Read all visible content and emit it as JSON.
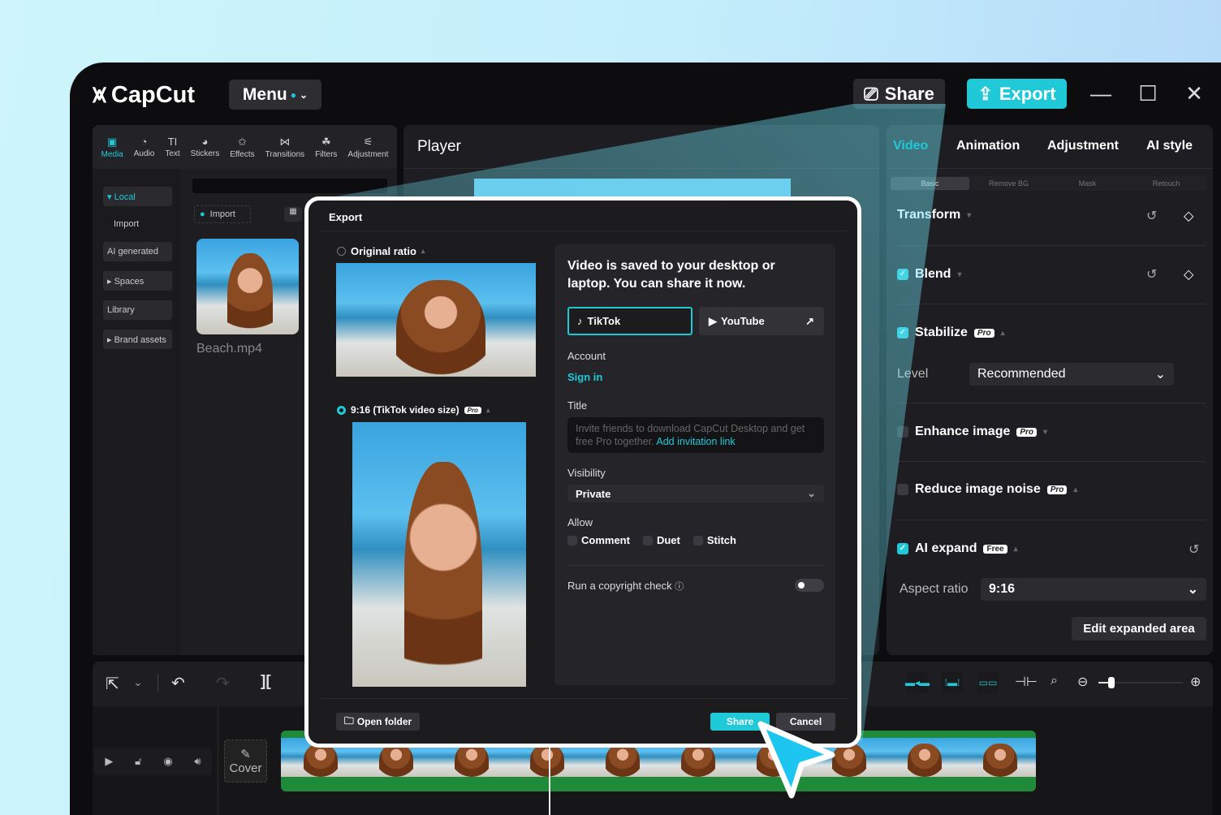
{
  "app": {
    "name": "CapCut",
    "menu_label": "Menu",
    "share_label": "Share",
    "export_label": "Export",
    "accent": "#20c9d8"
  },
  "window_controls": {
    "minimize": "—",
    "maximize": "☐",
    "close": "✕"
  },
  "toolbar": {
    "items": [
      {
        "label": "Media",
        "icon": "media-icon",
        "glyph": "▣"
      },
      {
        "label": "Audio",
        "icon": "audio-icon",
        "glyph": "◔"
      },
      {
        "label": "Text",
        "icon": "text-icon",
        "glyph": "TI"
      },
      {
        "label": "Stickers",
        "icon": "sticker-icon",
        "glyph": "◕"
      },
      {
        "label": "Effects",
        "icon": "effects-icon",
        "glyph": "✩"
      },
      {
        "label": "Transitions",
        "icon": "transitions-icon",
        "glyph": "⋈"
      },
      {
        "label": "Filters",
        "icon": "filters-icon",
        "glyph": "☘"
      },
      {
        "label": "Adjustment",
        "icon": "adjustment-icon",
        "glyph": "⚟"
      }
    ]
  },
  "sidebar": {
    "items": [
      {
        "label": "▾ Local"
      },
      {
        "label": "Import"
      },
      {
        "label": "AI generated"
      },
      {
        "label": "▸ Spaces"
      },
      {
        "label": "Library"
      },
      {
        "label": "▸ Brand assets"
      }
    ]
  },
  "media": {
    "import_label": "Import",
    "file_name": "Beach.mp4"
  },
  "player": {
    "title": "Player"
  },
  "right_panel": {
    "tabs": [
      "Video",
      "Animation",
      "Adjustment",
      "AI style"
    ],
    "sub_tabs": [
      "Basic",
      "Remove BG",
      "Mask",
      "Retouch"
    ],
    "transform": "Transform",
    "blend": "Blend",
    "stabilize": "Stabilize",
    "pro_badge": "Pro",
    "free_badge": "Free",
    "level_label": "Level",
    "level_value": "Recommended",
    "enhance": "Enhance image",
    "reduce_noise": "Reduce image noise",
    "ai_expand": "AI expand",
    "aspect_label": "Aspect ratio",
    "aspect_value": "9:16",
    "edit_expanded": "Edit expanded area"
  },
  "timeline": {
    "cover_label": "Cover",
    "zoom_level": 0.15
  },
  "dialog": {
    "title": "Export",
    "original_ratio": "Original ratio",
    "tiktok_ratio": "9:16 (TikTok video size)",
    "saved_message": "Video is saved to your desktop or laptop. You can share it now.",
    "platforms": [
      "TikTok",
      "YouTube"
    ],
    "account_label": "Account",
    "sign_in": "Sign in",
    "title_label": "Title",
    "title_placeholder": "Invite friends to download CapCut Desktop and get free Pro together.",
    "invite_link": "Add invitation link",
    "visibility_label": "Visibility",
    "visibility_value": "Private",
    "allow_label": "Allow",
    "allow_options": [
      "Comment",
      "Duet",
      "Stitch"
    ],
    "copyright_label": "Run a copyright check",
    "copyright_on": false,
    "open_folder": "Open folder",
    "share": "Share",
    "cancel": "Cancel"
  }
}
